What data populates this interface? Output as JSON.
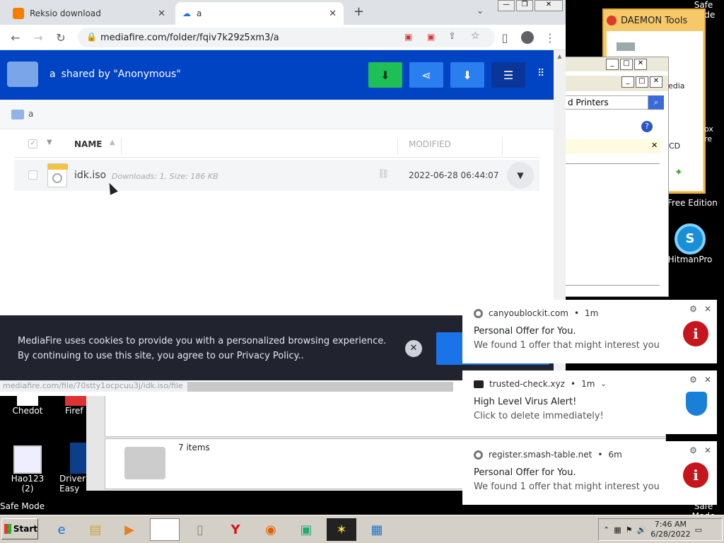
{
  "browser": {
    "tabs": [
      {
        "title": "Reksio download",
        "close": "✕"
      },
      {
        "title": "a",
        "close": "✕"
      }
    ],
    "new_tab": "+",
    "url": "mediafire.com/folder/fqiv7k29z5xm3/a",
    "window_controls": [
      "—",
      "❐",
      "✕"
    ]
  },
  "mediafire": {
    "folder_name": "a",
    "shared_by": "shared by \"Anonymous\"",
    "breadcrumb": "a",
    "columns": {
      "name": "NAME",
      "modified": "MODIFIED"
    },
    "files": [
      {
        "name": "idk.iso",
        "meta": "Downloads: 1, Size: 186 KB",
        "modified": "2022-06-28 06:44:07"
      }
    ],
    "cookie_line1": "MediaFire uses cookies to provide you with a personalized browsing experience.",
    "cookie_line2": "By continuing to use this site, you agree to our Privacy Policy..",
    "status_url": "mediafire.com/file/70stty1ocpcuu3j/idk.iso/file",
    "colors": {
      "header": "#0043c3",
      "accent_green": "#1fbf57",
      "accent_blue": "#1a73e8"
    }
  },
  "background_windows": {
    "daemon_title": "DAEMON Tools",
    "daemon_free": "Free Edition",
    "printers_label": "d Printers",
    "edia_text": "edia",
    "cd_text": "CD",
    "explorer_items": "7 items",
    "ox_text": "ox",
    "re_text": "re"
  },
  "notifications": [
    {
      "source": "canyoublockit.com",
      "age": "1m",
      "title": "Personal Offer for You.",
      "body": "We found 1 offer that might interest you",
      "icon": "info-icon"
    },
    {
      "source": "trusted-check.xyz",
      "age": "1m",
      "title": "High Level Virus Alert!",
      "body": "Click to delete immediately!",
      "icon": "shield-icon"
    },
    {
      "source": "register.smash-table.net",
      "age": "6m",
      "title": "Personal Offer for You.",
      "body": "We found 1 offer that might interest you",
      "icon": "info-icon"
    }
  ],
  "desktop": {
    "safe_mode": "Safe Mode",
    "icons": [
      {
        "label": "Chedot"
      },
      {
        "label": "Firef"
      },
      {
        "label": "Hao123 (2)"
      },
      {
        "label": "Driver Easy"
      },
      {
        "label": "HitmanPro"
      }
    ]
  },
  "taskbar": {
    "start": "Start",
    "time": "7:46 AM",
    "date": "6/28/2022"
  }
}
